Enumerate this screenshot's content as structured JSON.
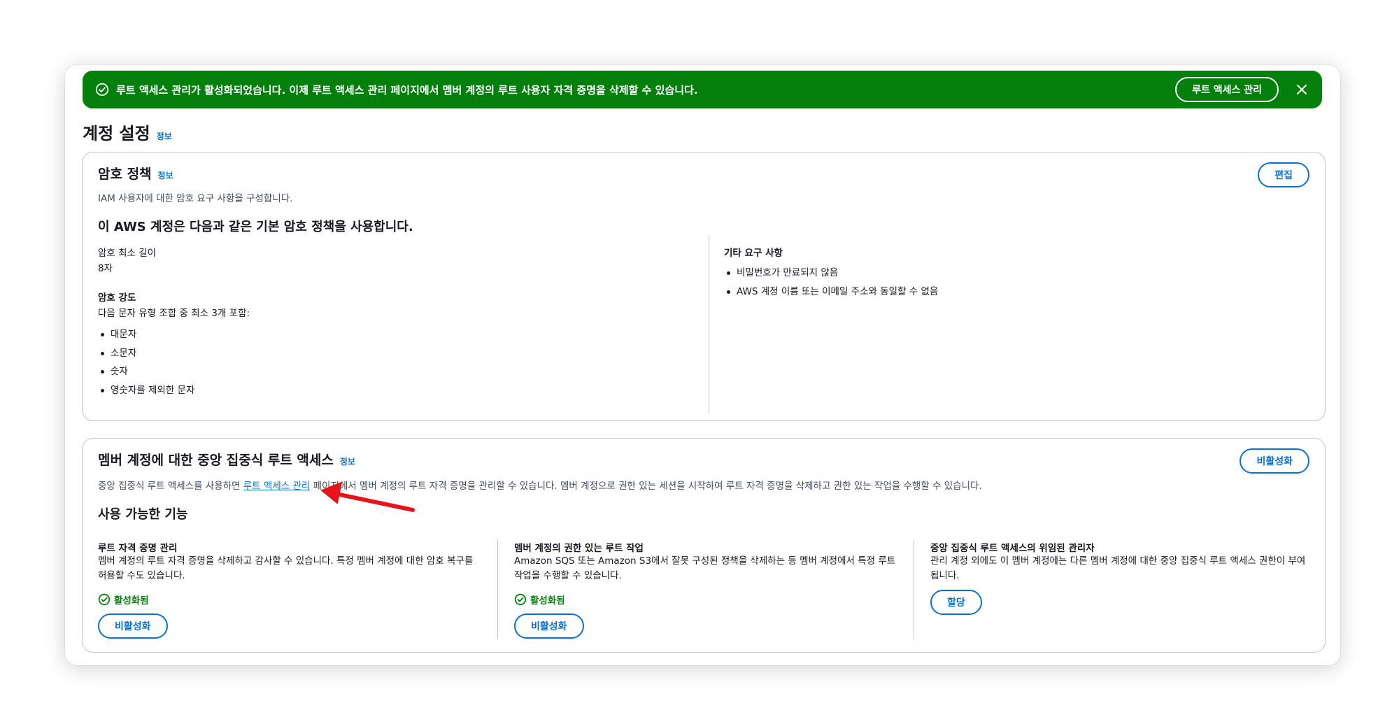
{
  "flash": {
    "message": "루트 액세스 관리가 활성화되었습니다. 이제 루트 액세스 관리 페이지에서 멤버 계정의 루트 사용자 자격 증명을 삭제할 수 있습니다.",
    "button_label": "루트 액세스 관리",
    "color": "#037f0c"
  },
  "page": {
    "title": "계정 설정",
    "info_label": "정보"
  },
  "password_policy": {
    "title": "암호 정책",
    "info_label": "정보",
    "description": "IAM 사용자에 대한 암호 요구 사항을 구성합니다.",
    "edit_button": "편집",
    "subheading": "이 AWS 계정은 다음과 같은 기본 암호 정책을 사용합니다.",
    "min_length_label": "암호 최소 길이",
    "min_length_value": "8자",
    "strength_label": "암호 강도",
    "strength_desc": "다음 문자 유형 조합 중 최소 3개 포함:",
    "strength_items": [
      "대문자",
      "소문자",
      "숫자",
      "영숫자를 제외한 문자"
    ],
    "other_label": "기타 요구 사항",
    "other_items": [
      "비밀번호가 만료되지 않음",
      "AWS 계정 이름 또는 이메일 주소와 동일할 수 없음"
    ]
  },
  "root_access": {
    "title": "멤버 계정에 대한 중앙 집중식 루트 액세스",
    "info_label": "정보",
    "disable_button": "비활성화",
    "desc_before": "중앙 집중식 루트 액세스를 사용하면 ",
    "desc_link": "루트 액세스 관리",
    "desc_after": " 페이지에서 멤버 계정의 루트 자격 증명을 관리할 수 있습니다. 멤버 계정으로 권한 있는 세션을 시작하여 루트 자격 증명을 삭제하고 권한 있는 작업을 수행할 수 있습니다.",
    "features_heading": "사용 가능한 기능",
    "features": [
      {
        "title": "루트 자격 증명 관리",
        "desc": "멤버 계정의 루트 자격 증명을 삭제하고 감사할 수 있습니다. 특정 멤버 계정에 대한 암호 복구를 허용할 수도 있습니다.",
        "status": "활성화됨",
        "button": "비활성화"
      },
      {
        "title": "멤버 계정의 권한 있는 루트 작업",
        "desc": "Amazon SQS 또는 Amazon S3에서 잘못 구성된 정책을 삭제하는 등 멤버 계정에서 특정 루트 작업을 수행할 수 있습니다.",
        "status": "활성화됨",
        "button": "비활성화"
      },
      {
        "title": "중앙 집중식 루트 액세스의 위임된 관리자",
        "desc": "관리 계정 외에도 이 멤버 계정에는 다른 멤버 계정에 대한 중앙 집중식 루트 액세스 권한이 부여됩니다.",
        "button": "할당"
      }
    ]
  },
  "colors": {
    "link": "#0972d3",
    "success": "#037f0c",
    "annotation_arrow": "#e8141c"
  }
}
